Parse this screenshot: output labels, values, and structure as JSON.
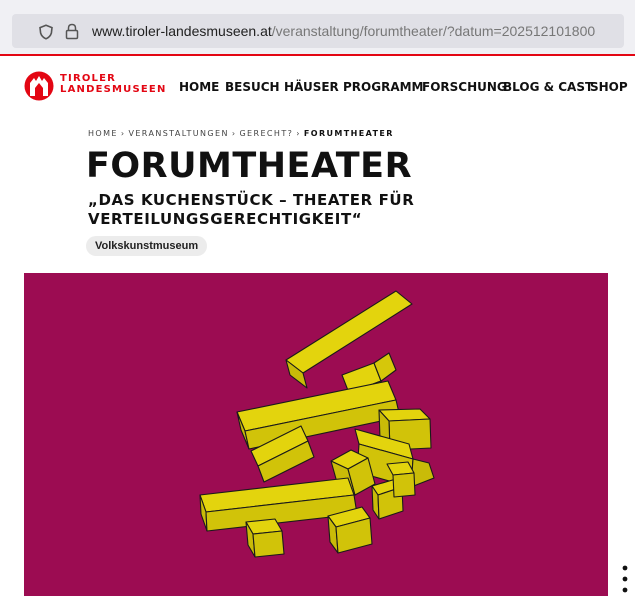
{
  "browser": {
    "url_host": "www.tiroler-landesmuseen.at",
    "url_path": "/veranstaltung/forumtheater/?datum=202512101800"
  },
  "site": {
    "logo_line1": "TIROLER",
    "logo_line2": "LANDESMUSEEN",
    "brand_color": "#e30613"
  },
  "nav": {
    "items": [
      "HOME",
      "BESUCH",
      "HÄUSER",
      "PROGRAMM",
      "FORSCHUNG",
      "BLOG & CAST",
      "SHOP"
    ]
  },
  "breadcrumb": {
    "items": [
      "HOME",
      "VERANSTALTUNGEN",
      "GERECHT?",
      "FORUMTHEATER"
    ],
    "separator": "›"
  },
  "page": {
    "title": "FORUMTHEATER",
    "subtitle": "„DAS KUCHENSTÜCK – THEATER FÜR VERTEILUNGSGERECHTIGKEIT“",
    "tag": "Volkskunstmuseum"
  },
  "hero": {
    "background_color": "#9c0c52",
    "block_color": "#e3d40d"
  },
  "icons": {
    "shield": "shield-icon",
    "lock": "lock-icon",
    "logo": "landesmuseen-logo-icon",
    "more": "more-vertical-icon"
  }
}
